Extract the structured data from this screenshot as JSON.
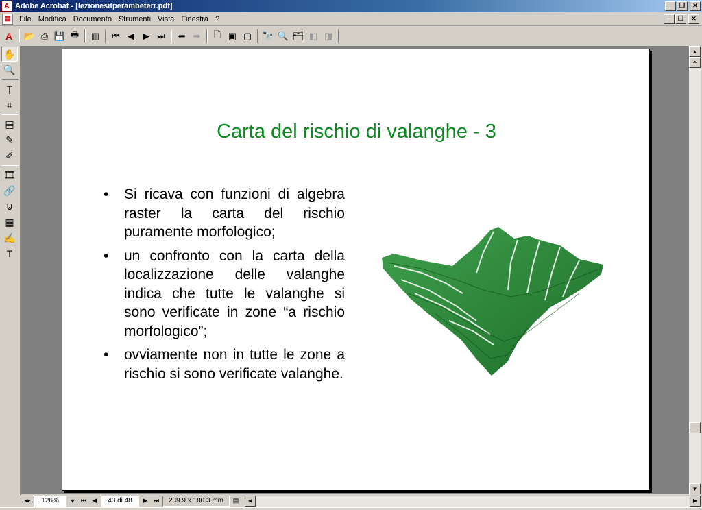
{
  "window": {
    "title": "Adobe Acrobat - [lezionesitperambeterr.pdf]"
  },
  "menu": {
    "items": [
      "File",
      "Modifica",
      "Documento",
      "Strumenti",
      "Vista",
      "Finestra",
      "?"
    ]
  },
  "toolbar": {
    "icons": [
      "acrobat-logo",
      "open-icon",
      "print-setup-icon",
      "save-icon",
      "print-icon",
      "show-navigation-icon",
      "first-page-icon",
      "previous-page-icon",
      "next-page-icon",
      "last-page-icon",
      "go-back-icon",
      "go-forward-icon",
      "actual-size-icon",
      "fit-page-icon",
      "fit-width-icon",
      "find-icon",
      "search-icon",
      "search-results-icon",
      "previous-highlight-icon",
      "next-highlight-icon"
    ]
  },
  "slide": {
    "title": "Carta del rischio di valanghe - 3",
    "bullet_char": "•",
    "bullets": [
      "Si ricava con funzioni di algebra raster la carta del rischio puramente morfologico;",
      "un confronto con la carta della localizzazione delle valanghe indica che tutte le valanghe si sono verificate in zone “a rischio morfologico”;",
      "ovviamente non in tutte le zone a rischio si sono verificate valanghe."
    ],
    "title_color": "#0b8a1f",
    "terrain_color": "#2e8b3a"
  },
  "status": {
    "zoom": "126%",
    "page": "43 di 48",
    "page_size": "239.9 x 180.3 mm"
  }
}
